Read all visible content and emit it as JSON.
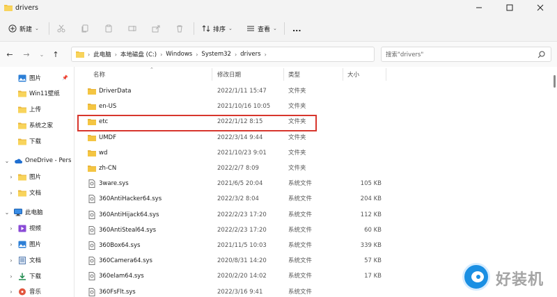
{
  "window": {
    "title": "drivers",
    "controls": [
      "minimize",
      "maximize",
      "close"
    ]
  },
  "toolbar": {
    "new_label": "新建",
    "sort_label": "排序",
    "view_label": "查看",
    "more_label": "..."
  },
  "address": {
    "crumbs": [
      "此电脑",
      "本地磁盘 (C:)",
      "Windows",
      "System32",
      "drivers"
    ],
    "search_placeholder": "搜索\"drivers\""
  },
  "sidebar": {
    "items": [
      {
        "label": "图片",
        "icon": "pictures-icon",
        "pinned": true
      },
      {
        "label": "Win11壁纸",
        "icon": "folder-icon"
      },
      {
        "label": "上传",
        "icon": "folder-icon"
      },
      {
        "label": "系统之家",
        "icon": "folder-icon"
      },
      {
        "label": "下载",
        "icon": "folder-icon"
      },
      {
        "label": "OneDrive - Pers",
        "icon": "cloud-icon",
        "expanded": true
      },
      {
        "label": "图片",
        "icon": "folder-icon"
      },
      {
        "label": "文档",
        "icon": "folder-icon"
      },
      {
        "label": "此电脑",
        "icon": "computer-icon",
        "expanded": true
      },
      {
        "label": "视频",
        "icon": "videos-icon"
      },
      {
        "label": "图片",
        "icon": "pictures-icon"
      },
      {
        "label": "文档",
        "icon": "documents-icon"
      },
      {
        "label": "下载",
        "icon": "downloads-icon"
      },
      {
        "label": "音乐",
        "icon": "music-icon"
      }
    ]
  },
  "columns": {
    "name": "名称",
    "date": "修改日期",
    "type": "类型",
    "size": "大小"
  },
  "files": [
    {
      "name": "DriverData",
      "date": "2022/1/11 15:47",
      "type": "文件夹",
      "size": "",
      "kind": "folder"
    },
    {
      "name": "en-US",
      "date": "2021/10/16 10:05",
      "type": "文件夹",
      "size": "",
      "kind": "folder"
    },
    {
      "name": "etc",
      "date": "2022/1/12 8:15",
      "type": "文件夹",
      "size": "",
      "kind": "folder",
      "highlighted": true
    },
    {
      "name": "UMDF",
      "date": "2022/3/14 9:44",
      "type": "文件夹",
      "size": "",
      "kind": "folder"
    },
    {
      "name": "wd",
      "date": "2021/10/23 9:01",
      "type": "文件夹",
      "size": "",
      "kind": "folder"
    },
    {
      "name": "zh-CN",
      "date": "2022/2/7 8:09",
      "type": "文件夹",
      "size": "",
      "kind": "folder"
    },
    {
      "name": "3ware.sys",
      "date": "2021/6/5 20:04",
      "type": "系统文件",
      "size": "105 KB",
      "kind": "file"
    },
    {
      "name": "360AntiHacker64.sys",
      "date": "2022/3/2 8:04",
      "type": "系统文件",
      "size": "204 KB",
      "kind": "file"
    },
    {
      "name": "360AntiHijack64.sys",
      "date": "2022/2/23 17:20",
      "type": "系统文件",
      "size": "112 KB",
      "kind": "file"
    },
    {
      "name": "360AntiSteal64.sys",
      "date": "2022/2/23 17:20",
      "type": "系统文件",
      "size": "60 KB",
      "kind": "file"
    },
    {
      "name": "360Box64.sys",
      "date": "2021/11/5 10:03",
      "type": "系统文件",
      "size": "339 KB",
      "kind": "file"
    },
    {
      "name": "360Camera64.sys",
      "date": "2020/8/31 14:20",
      "type": "系统文件",
      "size": "57 KB",
      "kind": "file"
    },
    {
      "name": "360elam64.sys",
      "date": "2020/2/20 14:02",
      "type": "系统文件",
      "size": "17 KB",
      "kind": "file"
    },
    {
      "name": "360FsFlt.sys",
      "date": "2022/3/16 9:41",
      "type": "系统文件",
      "size": "",
      "kind": "file"
    }
  ],
  "watermark": {
    "text": "好装机"
  },
  "colors": {
    "highlight": "#d7352c",
    "folder": "#f4c542",
    "accent": "#1a8fe3"
  }
}
